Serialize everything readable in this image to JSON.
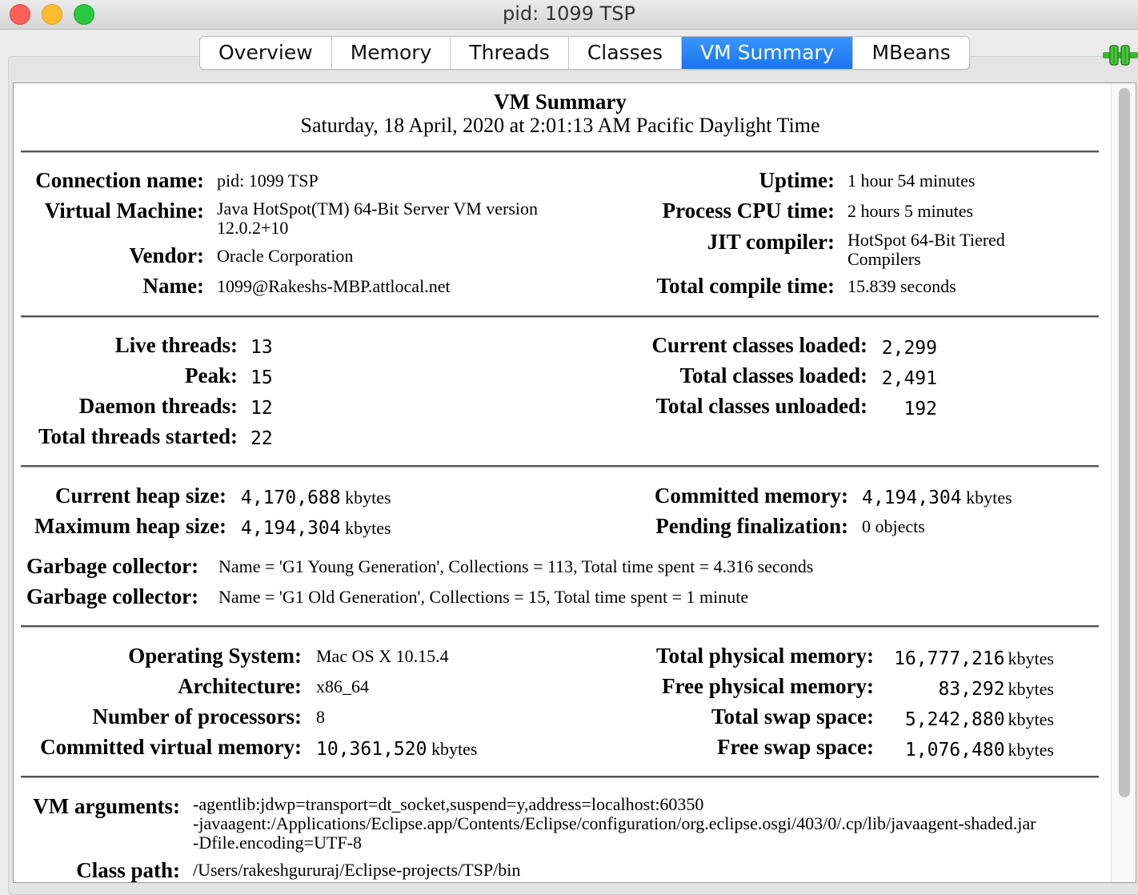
{
  "window": {
    "title": "pid: 1099 TSP"
  },
  "tabs": [
    {
      "label": "Overview"
    },
    {
      "label": "Memory"
    },
    {
      "label": "Threads"
    },
    {
      "label": "Classes"
    },
    {
      "label": "VM Summary",
      "active": true
    },
    {
      "label": "MBeans"
    }
  ],
  "colors": {
    "active_tab": "#1a74ef",
    "connection_icon": "#3bb52f"
  },
  "summary": {
    "title": "VM Summary",
    "date": "Saturday, 18 April, 2020 at 2:01:13 AM Pacific Daylight Time"
  },
  "section1": {
    "connection_name_label": "Connection name:",
    "connection_name": "pid: 1099 TSP",
    "vm_label": "Virtual Machine:",
    "vm_line1": "Java HotSpot(TM) 64-Bit Server VM version",
    "vm_line2": "12.0.2+10",
    "vendor_label": "Vendor:",
    "vendor": "Oracle Corporation",
    "name_label": "Name:",
    "name": "1099@Rakeshs-MBP.attlocal.net",
    "uptime_label": "Uptime:",
    "uptime": "1 hour 54 minutes",
    "cpu_label": "Process CPU time:",
    "cpu": "2 hours 5 minutes",
    "jit_label": "JIT compiler:",
    "jit_line1": "HotSpot 64-Bit Tiered",
    "jit_line2": "Compilers",
    "compile_label": "Total compile time:",
    "compile": "15.839 seconds"
  },
  "section2": {
    "live_label": "Live threads:",
    "live": "13",
    "peak_label": "Peak:",
    "peak": "15",
    "daemon_label": "Daemon threads:",
    "daemon": "12",
    "started_label": "Total threads started:",
    "started": "22",
    "current_classes_label": "Current classes loaded:",
    "current_classes": "2,299",
    "total_classes_label": "Total classes loaded:",
    "total_classes": "2,491",
    "unloaded_label": "Total classes unloaded:",
    "unloaded": "192"
  },
  "section3": {
    "heap_label": "Current heap size:",
    "heap": "4,170,688",
    "heap_unit": "kbytes",
    "max_heap_label": "Maximum heap size:",
    "max_heap": "4,194,304",
    "max_heap_unit": "kbytes",
    "committed_label": "Committed memory:",
    "committed": "4,194,304",
    "committed_unit": "kbytes",
    "pending_label": "Pending finalization:",
    "pending": "0 objects",
    "gc_label": "Garbage collector:",
    "gc1": "Name = 'G1 Young Generation', Collections = 113, Total time spent = 4.316 seconds",
    "gc2": "Name = 'G1 Old Generation', Collections = 15, Total time spent = 1 minute"
  },
  "section4": {
    "os_label": "Operating System:",
    "os": "Mac OS X 10.15.4",
    "arch_label": "Architecture:",
    "arch": "x86_64",
    "procs_label": "Number of processors:",
    "procs": "8",
    "cvm_label": "Committed virtual memory:",
    "cvm": "10,361,520",
    "cvm_unit": "kbytes",
    "tpm_label": "Total physical memory:",
    "tpm": "16,777,216",
    "tpm_unit": "kbytes",
    "fpm_label": "Free physical memory:",
    "fpm": "83,292",
    "fpm_unit": "kbytes",
    "tss_label": "Total swap space:",
    "tss": "5,242,880",
    "tss_unit": "kbytes",
    "fss_label": "Free swap space:",
    "fss": "1,076,480",
    "fss_unit": "kbytes"
  },
  "section5": {
    "args_label": "VM arguments:",
    "arg1": "-agentlib:jdwp=transport=dt_socket,suspend=y,address=localhost:60350",
    "arg2": "-javaagent:/Applications/Eclipse.app/Contents/Eclipse/configuration/org.eclipse.osgi/403/0/.cp/lib/javaagent-shaded.jar",
    "arg3": "-Dfile.encoding=UTF-8",
    "classpath_label": "Class path:",
    "classpath": "/Users/rakeshgururaj/Eclipse-projects/TSP/bin"
  }
}
